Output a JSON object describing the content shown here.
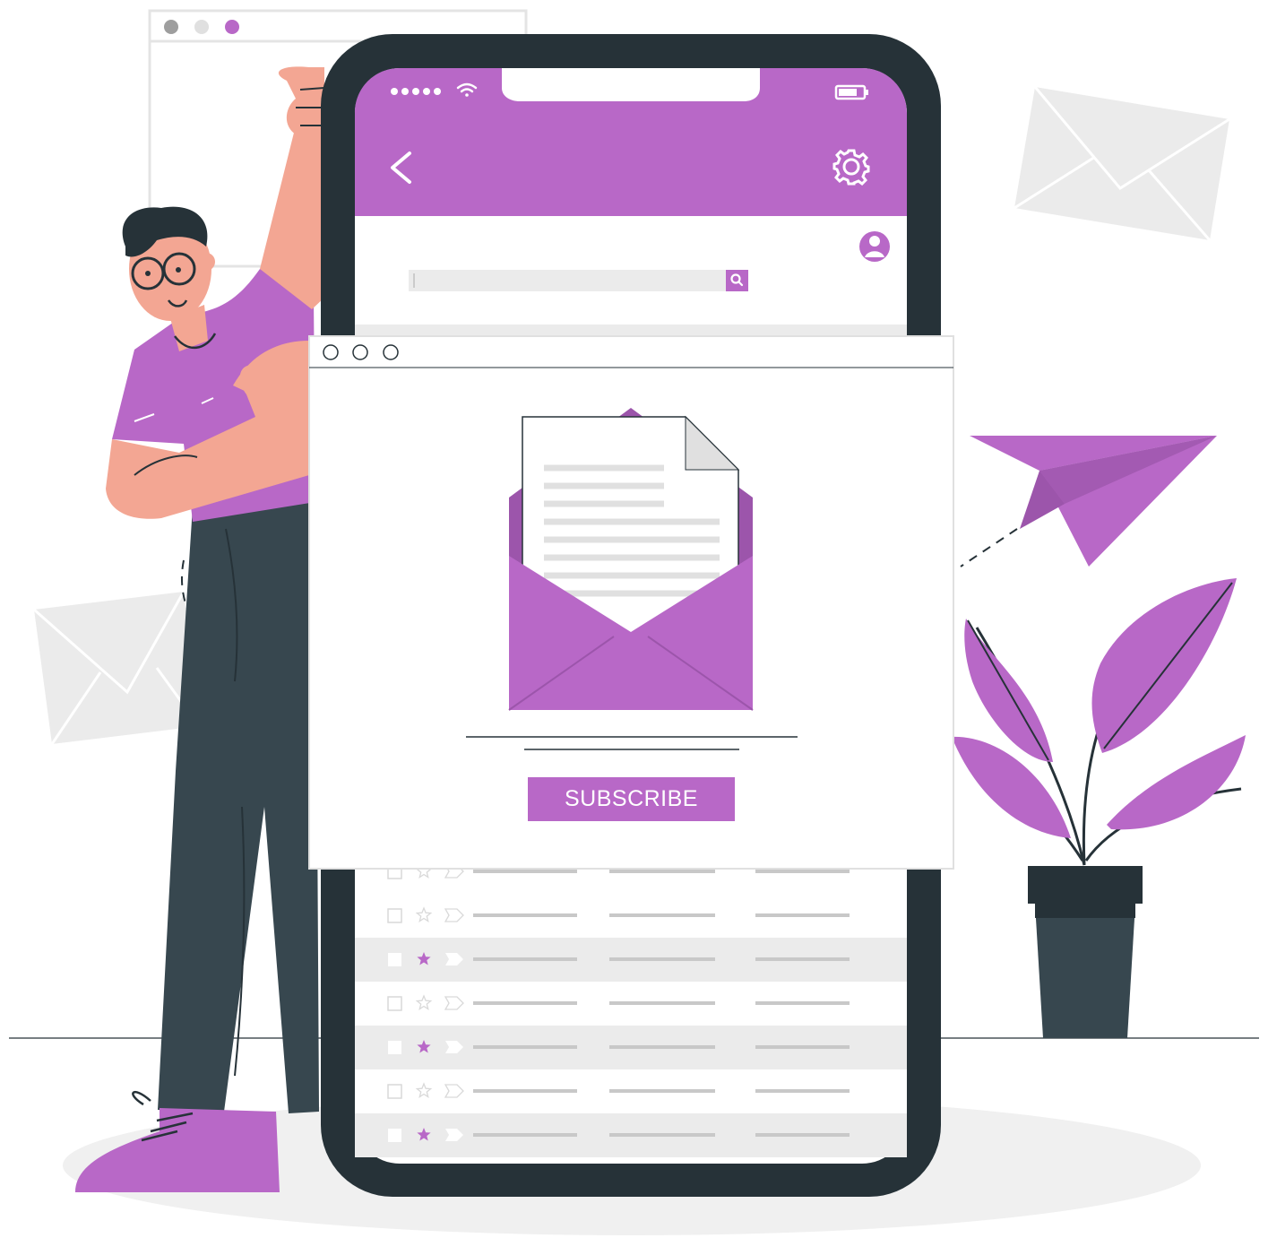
{
  "colors": {
    "accent": "#b868c7",
    "accent_dark": "#9c55ab",
    "dark": "#263238",
    "skin": "#f3a693",
    "light_gray": "#ebebeb",
    "line_gray": "#c8c8c8"
  },
  "phone": {
    "icons": [
      "signal-icon",
      "wifi-icon",
      "battery-icon",
      "back-arrow-icon",
      "gear-icon",
      "user-avatar-icon",
      "search-icon"
    ],
    "search": {
      "value": "",
      "placeholder": ""
    }
  },
  "popup": {
    "icons": [
      "envelope-letter-icon"
    ],
    "subscribe_label": "SUBSCRIBE"
  },
  "inbox": {
    "rows": [
      {
        "starred": false
      },
      {
        "starred": false
      },
      {
        "starred": true
      },
      {
        "starred": false
      },
      {
        "starred": true
      },
      {
        "starred": false
      },
      {
        "starred": true
      }
    ]
  }
}
